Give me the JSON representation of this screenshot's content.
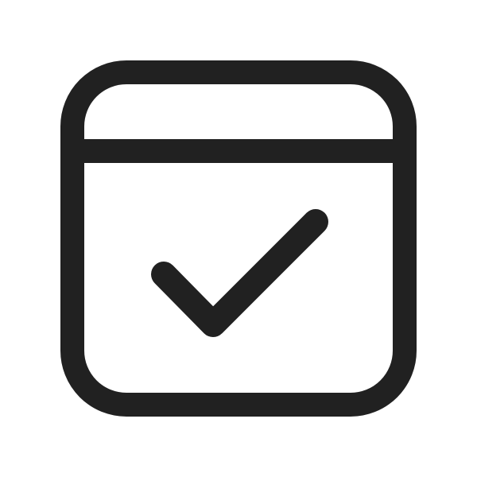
{
  "icon": {
    "name": "calendar-check-icon",
    "stroke_color": "#212121",
    "background_color": "#ffffff"
  }
}
